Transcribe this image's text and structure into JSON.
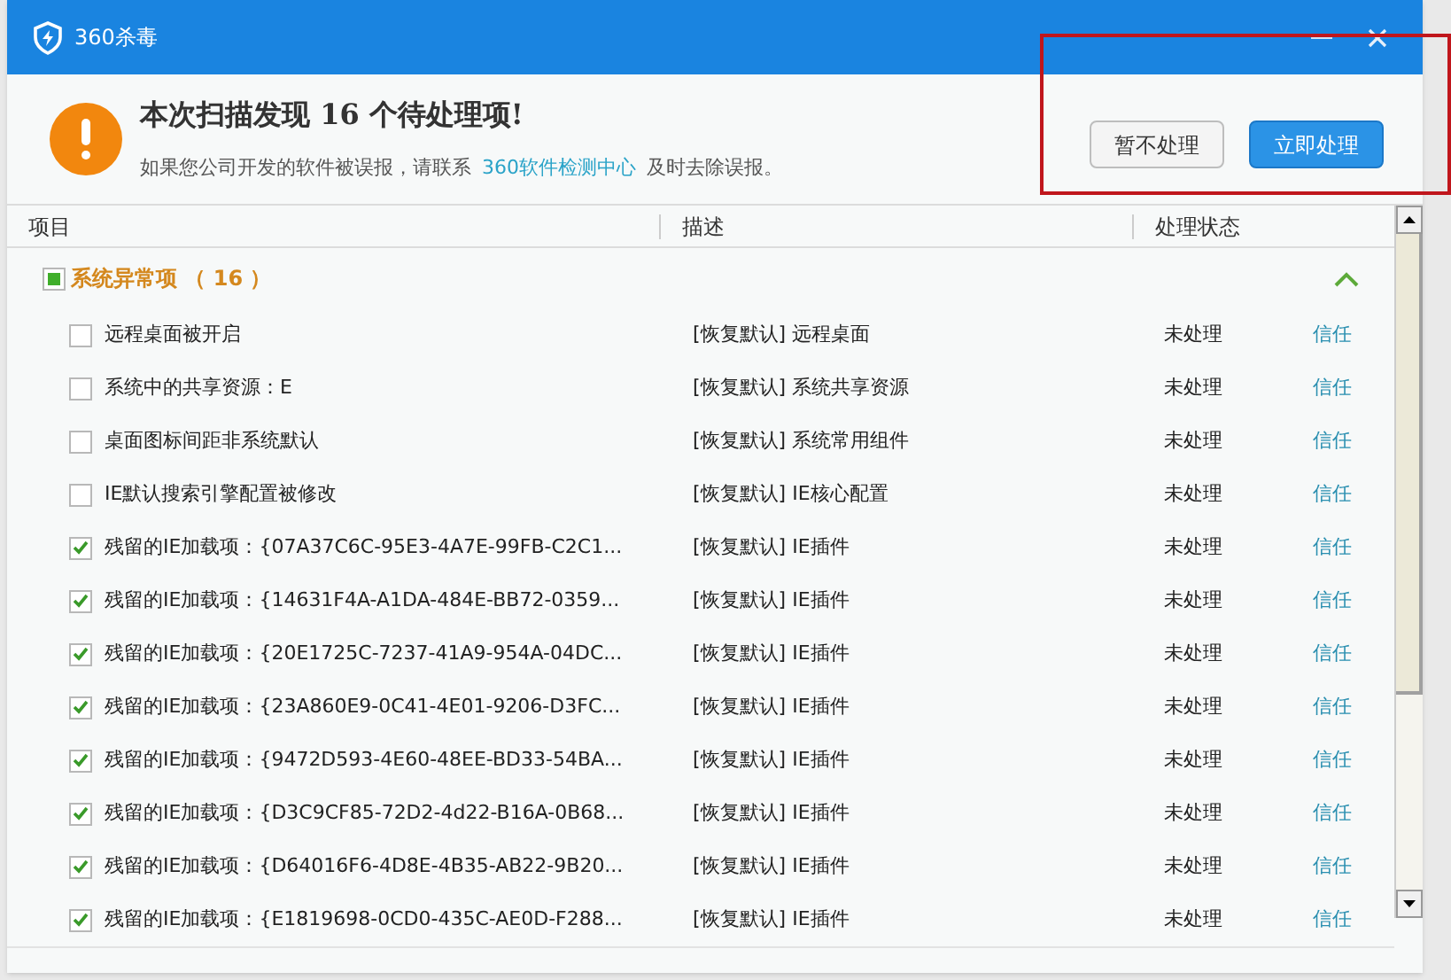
{
  "window": {
    "title": "360杀毒"
  },
  "header": {
    "title": "本次扫描发现 16 个待处理项!",
    "notice_before": "如果您公司开发的软件被误报，请联系",
    "notice_link": "360软件检测中心",
    "notice_after": "及时去除误报。"
  },
  "buttons": [
    {
      "label": "暂不处理",
      "kind": "secondary"
    },
    {
      "label": "立即处理",
      "kind": "primary"
    }
  ],
  "table": {
    "columns": [
      "项目",
      "描述",
      "处理状态"
    ],
    "group": {
      "label": "系统异常项 （ 16 ）",
      "checked": true,
      "mixed": true,
      "expanded": true
    },
    "rows": [
      {
        "item": "远程桌面被开启",
        "description": "[恢复默认] 远程桌面",
        "status": "未处理",
        "action": "信任",
        "checked": false
      },
      {
        "item": "系统中的共享资源：E",
        "description": "[恢复默认] 系统共享资源",
        "status": "未处理",
        "action": "信任",
        "checked": false
      },
      {
        "item": "桌面图标间距非系统默认",
        "description": "[恢复默认] 系统常用组件",
        "status": "未处理",
        "action": "信任",
        "checked": false
      },
      {
        "item": "IE默认搜索引擎配置被修改",
        "description": "[恢复默认] IE核心配置",
        "status": "未处理",
        "action": "信任",
        "checked": false
      },
      {
        "item": "残留的IE加载项：{07A37C6C-95E3-4A7E-99FB-C2C1...",
        "description": "[恢复默认] IE插件",
        "status": "未处理",
        "action": "信任",
        "checked": true
      },
      {
        "item": "残留的IE加载项：{14631F4A-A1DA-484E-BB72-0359...",
        "description": "[恢复默认] IE插件",
        "status": "未处理",
        "action": "信任",
        "checked": true
      },
      {
        "item": "残留的IE加载项：{20E1725C-7237-41A9-954A-04DC...",
        "description": "[恢复默认] IE插件",
        "status": "未处理",
        "action": "信任",
        "checked": true
      },
      {
        "item": "残留的IE加载项：{23A860E9-0C41-4E01-9206-D3FC...",
        "description": "[恢复默认] IE插件",
        "status": "未处理",
        "action": "信任",
        "checked": true
      },
      {
        "item": "残留的IE加载项：{9472D593-4E60-48EE-BD33-54BA...",
        "description": "[恢复默认] IE插件",
        "status": "未处理",
        "action": "信任",
        "checked": true
      },
      {
        "item": "残留的IE加载项：{D3C9CF85-72D2-4d22-B16A-0B68...",
        "description": "[恢复默认] IE插件",
        "status": "未处理",
        "action": "信任",
        "checked": true
      },
      {
        "item": "残留的IE加载项：{D64016F6-4D8E-4B35-AB22-9B20...",
        "description": "[恢复默认] IE插件",
        "status": "未处理",
        "action": "信任",
        "checked": true
      },
      {
        "item": "残留的IE加载项：{E1819698-0CD0-435C-AE0D-F288...",
        "description": "[恢复默认] IE插件",
        "status": "未处理",
        "action": "信任",
        "checked": true
      }
    ]
  }
}
